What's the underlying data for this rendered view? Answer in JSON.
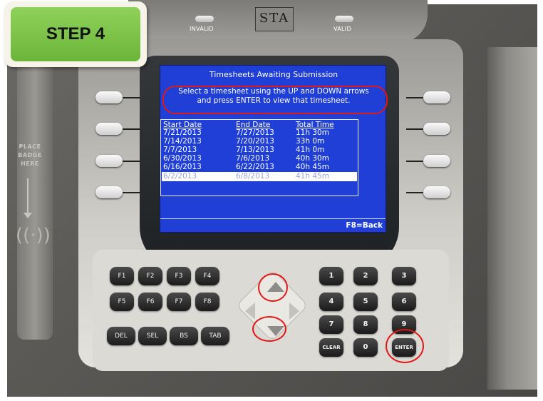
{
  "step": {
    "label": "STEP 4"
  },
  "device": {
    "invalid_label": "INVALID",
    "valid_label": "VALID",
    "logo_text": "STA",
    "badge_text": [
      "PLACE",
      "BADGE",
      "HERE"
    ]
  },
  "lcd": {
    "title": "Timesheets Awaiting Submission",
    "instruction_line1": "Select a timesheet using the UP and DOWN arrows",
    "instruction_line2": "and press ENTER to view that timesheet.",
    "columns": [
      "Start Date",
      "End Date",
      "Total Time"
    ],
    "rows": [
      [
        "7/21/2013",
        "7/27/2013",
        "11h 30m"
      ],
      [
        "7/14/2013",
        "7/20/2013",
        "33h 0m"
      ],
      [
        "7/7/2013",
        "7/13/2013",
        "41h 0m"
      ],
      [
        "6/30/2013",
        "7/6/2013",
        "40h 30m"
      ],
      [
        "6/16/2013",
        "6/22/2013",
        "40h 45m"
      ],
      [
        "6/2/2013",
        "6/8/2013",
        "41h 45m"
      ]
    ],
    "selected_row": 5,
    "footer": "F8=Back",
    "background_color": "#1f3fd6"
  },
  "keys": {
    "function": [
      "F1",
      "F2",
      "F3",
      "F4",
      "F5",
      "F6",
      "F7",
      "F8"
    ],
    "edit": [
      "DEL",
      "SEL",
      "BS",
      "TAB"
    ],
    "numbers": [
      "1",
      "2",
      "3",
      "4",
      "5",
      "6",
      "7",
      "8",
      "9"
    ],
    "clear": "CLEAR",
    "zero": "0",
    "enter": "ENTER"
  },
  "annotation_color": "#e01818",
  "step_color": "#7cc24a"
}
